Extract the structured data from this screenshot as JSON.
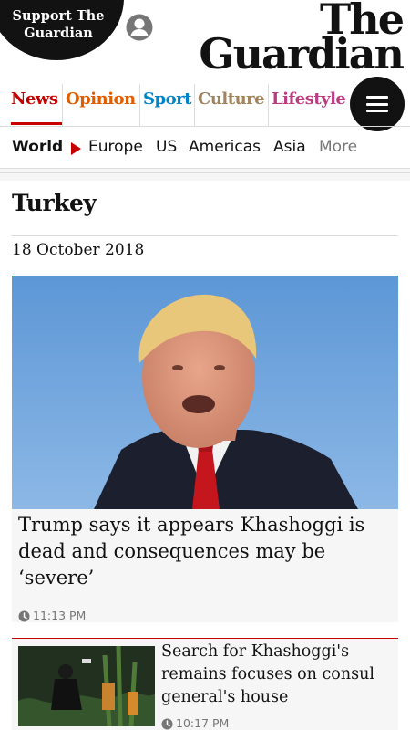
{
  "header": {
    "support_line1": "Support The",
    "support_line2": "Guardian",
    "account_icon": "account-icon",
    "logo_line1": "The",
    "logo_line2": "Guardian"
  },
  "pillars": [
    {
      "label": "News",
      "color": "#c70000",
      "active": true
    },
    {
      "label": "Opinion",
      "color": "#e05e00"
    },
    {
      "label": "Sport",
      "color": "#0084c6"
    },
    {
      "label": "Culture",
      "color": "#a1845c"
    },
    {
      "label": "Lifestyle",
      "color": "#bb3b80"
    }
  ],
  "menu_icon": "hamburger-menu-icon",
  "subnav": {
    "current": "World",
    "items": [
      "Europe",
      "US",
      "Americas",
      "Asia"
    ],
    "more": "More"
  },
  "section": {
    "title": "Turkey",
    "date": "18 October 2018"
  },
  "articles": [
    {
      "headline": "Trump says it appears Khashoggi is dead and consequences may be ‘severe’",
      "time": "11:13 PM"
    },
    {
      "headline": "Search for Khashoggi's remains focuses on consul general's house",
      "time": "10:17 PM"
    }
  ],
  "colors": {
    "accent": "#c70000",
    "ink": "#121212",
    "card_bg": "#f6f6f6"
  }
}
